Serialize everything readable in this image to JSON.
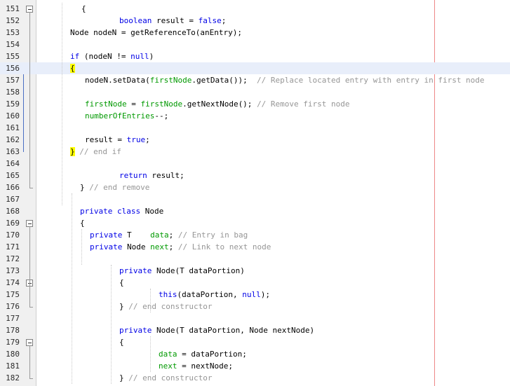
{
  "editor": {
    "lines": [
      {
        "n": "151",
        "indent": 116,
        "tokens": [
          {
            "t": "{",
            "c": ""
          }
        ]
      },
      {
        "n": "152",
        "indent": 170,
        "tokens": [
          {
            "t": "boolean",
            "c": "kw"
          },
          {
            "t": " result = ",
            "c": ""
          },
          {
            "t": "false",
            "c": "kw"
          },
          {
            "t": ";",
            "c": ""
          }
        ]
      },
      {
        "n": "153",
        "indent": 100,
        "tokens": [
          {
            "t": "Node nodeN = getReferenceTo(anEntry);",
            "c": ""
          }
        ]
      },
      {
        "n": "154",
        "indent": 100,
        "tokens": []
      },
      {
        "n": "155",
        "indent": 100,
        "tokens": [
          {
            "t": "if",
            "c": "kw"
          },
          {
            "t": " (nodeN != ",
            "c": ""
          },
          {
            "t": "null",
            "c": "kw"
          },
          {
            "t": ")",
            "c": ""
          }
        ]
      },
      {
        "n": "156",
        "indent": 100,
        "tokens": [
          {
            "t": "{",
            "c": "br"
          }
        ]
      },
      {
        "n": "157",
        "indent": 121,
        "tokens": [
          {
            "t": "nodeN.setData(",
            "c": ""
          },
          {
            "t": "firstNode",
            "c": "fld"
          },
          {
            "t": ".getData());  ",
            "c": ""
          },
          {
            "t": "// Replace located entry with entry in first node",
            "c": "cm"
          }
        ]
      },
      {
        "n": "158",
        "indent": 121,
        "tokens": []
      },
      {
        "n": "159",
        "indent": 121,
        "tokens": [
          {
            "t": "firstNode",
            "c": "fld"
          },
          {
            "t": " = ",
            "c": ""
          },
          {
            "t": "firstNode",
            "c": "fld"
          },
          {
            "t": ".getNextNode(); ",
            "c": ""
          },
          {
            "t": "// Remove first node",
            "c": "cm"
          }
        ]
      },
      {
        "n": "160",
        "indent": 121,
        "tokens": [
          {
            "t": "numberOfEntries",
            "c": "fld"
          },
          {
            "t": "--;",
            "c": ""
          }
        ]
      },
      {
        "n": "161",
        "indent": 121,
        "tokens": []
      },
      {
        "n": "162",
        "indent": 121,
        "tokens": [
          {
            "t": "result = ",
            "c": ""
          },
          {
            "t": "true",
            "c": "kw"
          },
          {
            "t": ";",
            "c": ""
          }
        ]
      },
      {
        "n": "163",
        "indent": 100,
        "tokens": [
          {
            "t": "}",
            "c": "br"
          },
          {
            "t": " ",
            "c": ""
          },
          {
            "t": "// end if",
            "c": "cm"
          }
        ]
      },
      {
        "n": "164",
        "indent": 100,
        "tokens": []
      },
      {
        "n": "165",
        "indent": 170,
        "tokens": [
          {
            "t": "return",
            "c": "kw"
          },
          {
            "t": " result;",
            "c": ""
          }
        ]
      },
      {
        "n": "166",
        "indent": 114,
        "tokens": [
          {
            "t": "} ",
            "c": ""
          },
          {
            "t": "// end remove",
            "c": "cm"
          }
        ]
      },
      {
        "n": "167",
        "indent": 114,
        "tokens": []
      },
      {
        "n": "168",
        "indent": 114,
        "tokens": [
          {
            "t": "private",
            "c": "kw"
          },
          {
            "t": " ",
            "c": ""
          },
          {
            "t": "class",
            "c": "kw"
          },
          {
            "t": " Node",
            "c": ""
          }
        ]
      },
      {
        "n": "169",
        "indent": 114,
        "tokens": [
          {
            "t": "{",
            "c": ""
          }
        ]
      },
      {
        "n": "170",
        "indent": 128,
        "tokens": [
          {
            "t": "private",
            "c": "kw"
          },
          {
            "t": " T    ",
            "c": ""
          },
          {
            "t": "data",
            "c": "fld"
          },
          {
            "t": "; ",
            "c": ""
          },
          {
            "t": "// Entry in bag",
            "c": "cm"
          }
        ]
      },
      {
        "n": "171",
        "indent": 128,
        "tokens": [
          {
            "t": "private",
            "c": "kw"
          },
          {
            "t": " Node ",
            "c": ""
          },
          {
            "t": "next",
            "c": "fld"
          },
          {
            "t": "; ",
            "c": ""
          },
          {
            "t": "// Link to next node",
            "c": "cm"
          }
        ]
      },
      {
        "n": "172",
        "indent": 128,
        "tokens": []
      },
      {
        "n": "173",
        "indent": 170,
        "tokens": [
          {
            "t": "private",
            "c": "kw"
          },
          {
            "t": " Node(T dataPortion)",
            "c": ""
          }
        ]
      },
      {
        "n": "174",
        "indent": 170,
        "tokens": [
          {
            "t": "{",
            "c": ""
          }
        ]
      },
      {
        "n": "175",
        "indent": 226,
        "tokens": [
          {
            "t": "this",
            "c": "kw"
          },
          {
            "t": "(dataPortion, ",
            "c": ""
          },
          {
            "t": "null",
            "c": "kw"
          },
          {
            "t": ");",
            "c": ""
          }
        ]
      },
      {
        "n": "176",
        "indent": 170,
        "tokens": [
          {
            "t": "} ",
            "c": ""
          },
          {
            "t": "// end constructor",
            "c": "cm"
          }
        ]
      },
      {
        "n": "177",
        "indent": 170,
        "tokens": []
      },
      {
        "n": "178",
        "indent": 170,
        "tokens": [
          {
            "t": "private",
            "c": "kw"
          },
          {
            "t": " Node(T dataPortion, Node nextNode)",
            "c": ""
          }
        ]
      },
      {
        "n": "179",
        "indent": 170,
        "tokens": [
          {
            "t": "{",
            "c": ""
          }
        ]
      },
      {
        "n": "180",
        "indent": 226,
        "tokens": [
          {
            "t": "data",
            "c": "fld"
          },
          {
            "t": " = dataPortion;",
            "c": ""
          }
        ]
      },
      {
        "n": "181",
        "indent": 226,
        "tokens": [
          {
            "t": "next",
            "c": "fld"
          },
          {
            "t": " = nextNode;",
            "c": ""
          }
        ]
      },
      {
        "n": "182",
        "indent": 170,
        "tokens": [
          {
            "t": "} ",
            "c": ""
          },
          {
            "t": "// end constructor",
            "c": "cm"
          }
        ]
      }
    ],
    "fold_open_lines": [
      "151",
      "169",
      "174",
      "179"
    ],
    "fold_end_lines": [
      "166",
      "176",
      "182"
    ],
    "current_line": "156",
    "colors": {
      "keyword": "#0000e6",
      "field": "#009900",
      "comment": "#969696",
      "brace_match": "#ffff00",
      "margin_line": "#e88888"
    }
  }
}
